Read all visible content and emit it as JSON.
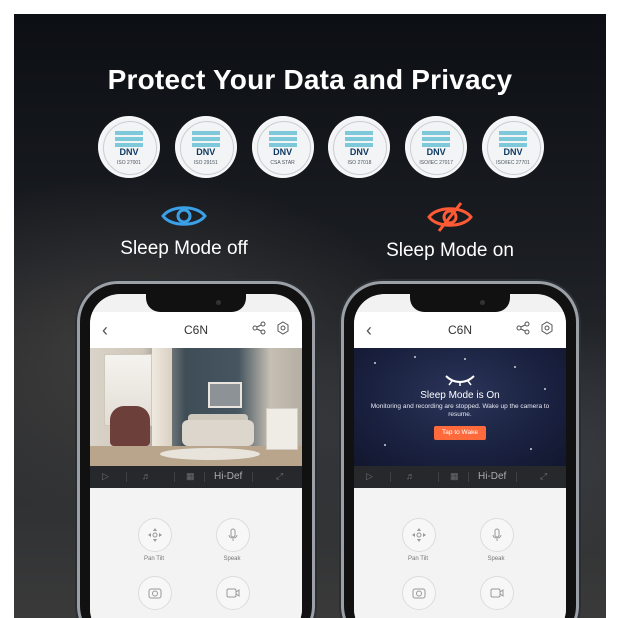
{
  "headline": "Protect Your Data and Privacy",
  "certificates": [
    {
      "brand": "DNV",
      "standard": "ISO 27001"
    },
    {
      "brand": "DNV",
      "standard": "ISO 29151"
    },
    {
      "brand": "DNV",
      "standard": "CSA STAR"
    },
    {
      "brand": "DNV",
      "standard": "ISO 27018"
    },
    {
      "brand": "DNV",
      "standard": "ISO/IEC 27017"
    },
    {
      "brand": "DNV",
      "standard": "ISO/IEC 27701"
    }
  ],
  "modes": {
    "off": {
      "label": "Sleep Mode off",
      "icon": "eye-icon",
      "color": "#3aa0e8"
    },
    "on": {
      "label": "Sleep Mode on",
      "icon": "eye-slash-icon",
      "color": "#ff5a36"
    }
  },
  "phone_left": {
    "device_name": "C6N",
    "quality": "Hi-Def",
    "controls": [
      "Pan Tilt",
      "Speak"
    ]
  },
  "phone_right": {
    "device_name": "C6N",
    "quality": "Hi-Def",
    "sleep_title": "Sleep Mode is On",
    "sleep_desc": "Monitoring and recording are stopped. Wake up the camera to resume.",
    "wake_button": "Tap to Wake",
    "controls": [
      "Pan Tilt",
      "Speak"
    ]
  }
}
